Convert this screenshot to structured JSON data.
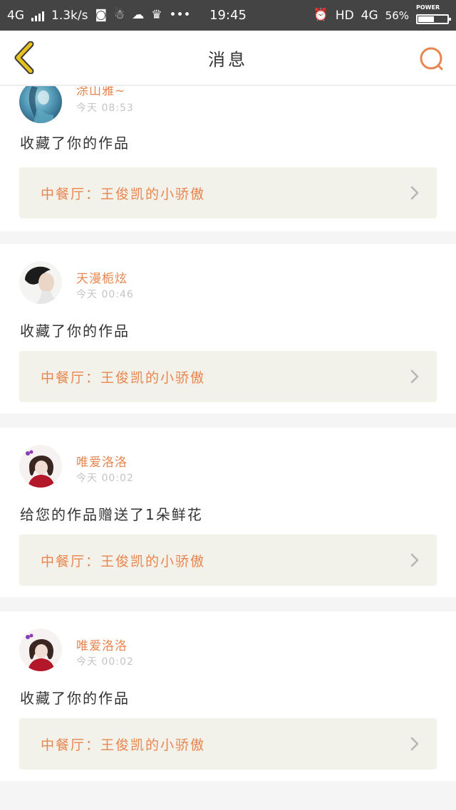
{
  "status_bar": {
    "network": "4G",
    "speed": "1.3k/s",
    "time": "19:45",
    "hd": "HD",
    "network_right": "4G",
    "battery_percent": "56%",
    "battery_label": "POWER",
    "battery_level": 0.56
  },
  "header": {
    "title": "消息"
  },
  "messages": [
    {
      "username": "涂山雅~",
      "time": "今天 08:53",
      "text": "收藏了你的作品",
      "work": "中餐厅：王俊凯的小骄傲"
    },
    {
      "username": "天漫栀炫",
      "time": "今天 00:46",
      "text": "收藏了你的作品",
      "work": "中餐厅：王俊凯的小骄傲"
    },
    {
      "username": "唯爱洛洛",
      "time": "今天 00:02",
      "text": "给您的作品赠送了1朵鲜花",
      "work": "中餐厅：王俊凯的小骄傲"
    },
    {
      "username": "唯爱洛洛",
      "time": "今天 00:02",
      "text": "收藏了你的作品",
      "work": "中餐厅：王俊凯的小骄傲"
    }
  ],
  "colors": {
    "accent": "#e8864f",
    "back_icon": "#e8c21c",
    "status_bar": "#444444"
  }
}
